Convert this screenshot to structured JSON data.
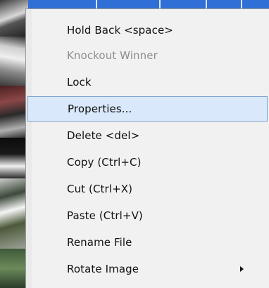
{
  "context_menu": {
    "items": [
      {
        "label": "Hold Back <space>",
        "enabled": true
      },
      {
        "label": "Knockout Winner",
        "enabled": false
      },
      {
        "label": "Lock",
        "enabled": true
      },
      {
        "label": "Properties...",
        "enabled": true,
        "highlighted": true
      },
      {
        "label": "Delete <del>",
        "enabled": true
      },
      {
        "label": "Copy (Ctrl+C)",
        "enabled": true
      },
      {
        "label": "Cut (Ctrl+X)",
        "enabled": true
      },
      {
        "label": "Paste (Ctrl+V)",
        "enabled": true
      },
      {
        "label": "Rename File",
        "enabled": true
      },
      {
        "label": "Rotate Image",
        "enabled": true,
        "has_submenu": true,
        "submenu_icon": "chevron-right-icon"
      }
    ]
  },
  "colors": {
    "menu_background": "#f1f1f1",
    "highlight_background": "#d9e8fa",
    "highlight_border": "#7da2ce",
    "disabled_text": "#8e8e8e",
    "selection_blue": "#2f6fd6"
  }
}
